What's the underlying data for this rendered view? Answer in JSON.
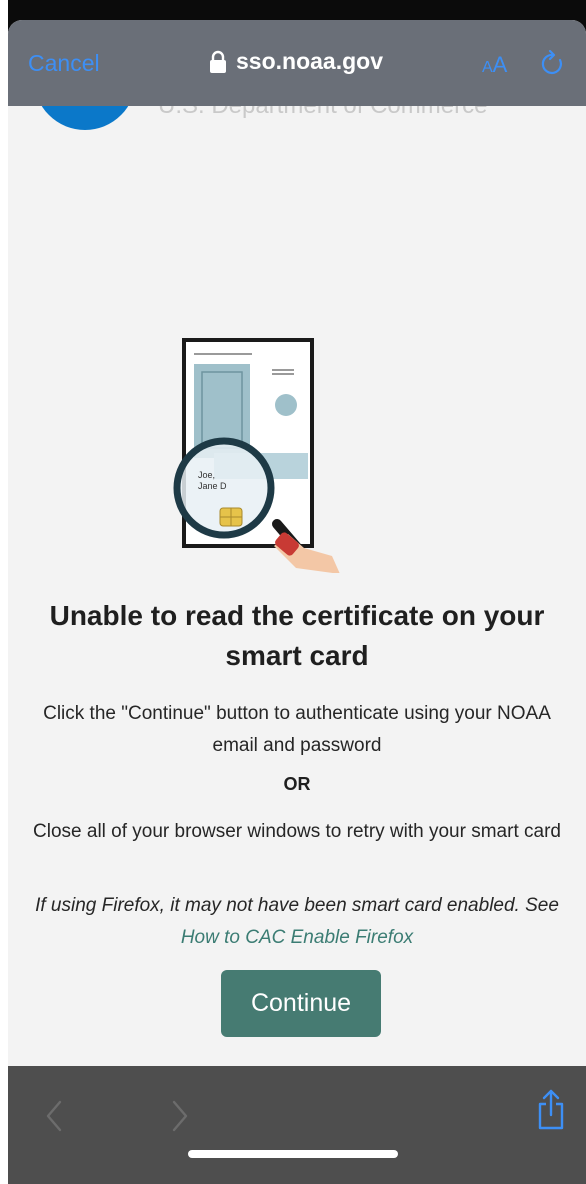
{
  "toolbar": {
    "cancel_label": "Cancel",
    "domain": "sso.noaa.gov",
    "text_size_small": "A",
    "text_size_large": "A"
  },
  "header_logo": {
    "partial_text": "U.S. Department of Commerce"
  },
  "card_illustration": {
    "name_line1": "Joe,",
    "name_line2": "Jane D"
  },
  "content": {
    "heading": "Unable to read the certificate on your smart card",
    "instruction_continue": "Click the \"Continue\" button to authenticate using your NOAA email and password",
    "or_label": "OR",
    "instruction_retry": "Close all of your browser windows to retry with your smart card",
    "firefox_note": "If using Firefox, it may not have been smart card enabled. See",
    "firefox_link": "How to CAC Enable Firefox",
    "continue_label": "Continue"
  },
  "colors": {
    "accent_blue": "#3d8ff5",
    "button_green": "#467b72",
    "link_green": "#3b7c73",
    "toolbar_gray": "#6a6f78",
    "bottombar_gray": "#4e4e4e"
  },
  "icons": {
    "lock": "lock-icon",
    "reload": "reload-icon",
    "back": "chevron-left-icon",
    "forward": "chevron-right-icon",
    "share": "share-icon"
  }
}
